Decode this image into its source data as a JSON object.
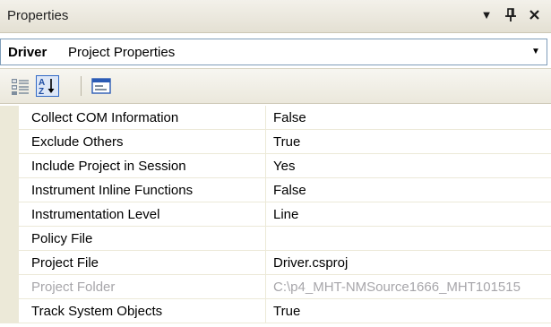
{
  "window": {
    "title": "Properties",
    "dropdown_glyph": "▼",
    "pin_glyph": "2",
    "close_glyph": "✕"
  },
  "selector": {
    "object_name": "Driver",
    "object_type": "Project Properties",
    "arrow_glyph": "▼"
  },
  "toolbar": {
    "buttons": [
      {
        "name": "categorized-icon",
        "pressed": false
      },
      {
        "name": "alphabetical-icon",
        "pressed": true
      },
      {
        "name": "property-pages-icon",
        "pressed": false
      }
    ]
  },
  "properties": [
    {
      "name": "Collect COM Information",
      "value": "False",
      "readonly": false
    },
    {
      "name": "Exclude Others",
      "value": "True",
      "readonly": false
    },
    {
      "name": "Include Project in Session",
      "value": "Yes",
      "readonly": false
    },
    {
      "name": "Instrument Inline Functions",
      "value": "False",
      "readonly": false
    },
    {
      "name": "Instrumentation Level",
      "value": "Line",
      "readonly": false
    },
    {
      "name": "Policy File",
      "value": "",
      "readonly": false
    },
    {
      "name": "Project File",
      "value": "Driver.csproj",
      "readonly": false
    },
    {
      "name": "Project Folder",
      "value": "C:\\p4_MHT-NMSource1666_MHT101515",
      "readonly": true
    },
    {
      "name": "Track System Objects",
      "value": "True",
      "readonly": false
    }
  ],
  "colors": {
    "margin": "#ece9d8",
    "readonly_text": "#a7a6aa",
    "selected_button_border": "#3169c6"
  }
}
